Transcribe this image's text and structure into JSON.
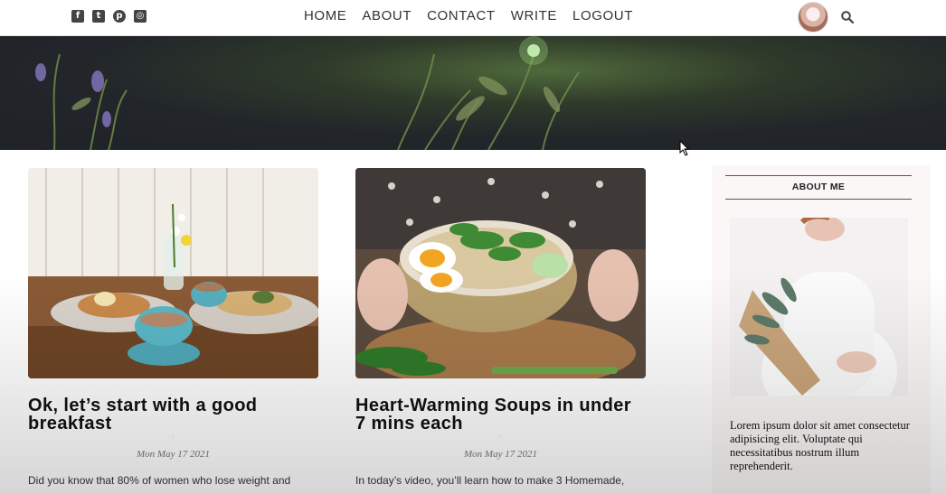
{
  "nav": {
    "socials": [
      {
        "icon": "facebook-icon",
        "glyph": "f"
      },
      {
        "icon": "twitter-icon",
        "glyph": "t"
      },
      {
        "icon": "pinterest-icon",
        "glyph": "p"
      },
      {
        "icon": "instagram-icon",
        "glyph": "◎"
      }
    ],
    "links": [
      "HOME",
      "ABOUT",
      "CONTACT",
      "WRITE",
      "LOGOUT"
    ]
  },
  "posts": [
    {
      "title": "Ok, let’s start with a good breakfast",
      "dot": "·",
      "date": "Mon May 17 2021",
      "excerpt": "Did you know that 80% of women who lose weight and"
    },
    {
      "title": "Heart-Warming Soups in under 7 mins each",
      "dot": "·",
      "date": "Mon May 17 2021",
      "excerpt": "In today’s video, you’ll learn how to make 3 Homemade,"
    }
  ],
  "sidebar": {
    "heading": "ABOUT ME",
    "text": "Lorem ipsum dolor sit amet consectetur adipisicing elit. Voluptate qui necessitatibus nostrum illum reprehenderit."
  },
  "colors": {
    "hero_dark": "#22262a",
    "nav_text": "#333333",
    "sidebar_bg": "#fbf7f7"
  }
}
